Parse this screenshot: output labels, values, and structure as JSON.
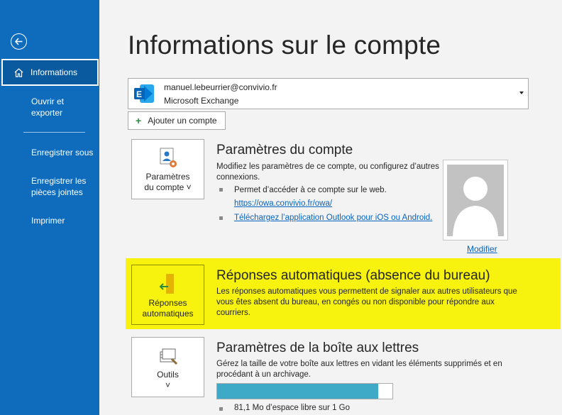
{
  "sidebar": {
    "back_icon": "back-arrow-icon",
    "items": [
      {
        "label": "Informations",
        "icon": "home-icon",
        "active": true
      },
      {
        "label": "Ouvrir et exporter"
      },
      {
        "label": "Enregistrer sous"
      },
      {
        "label": "Enregistrer les pièces jointes"
      },
      {
        "label": "Imprimer"
      }
    ]
  },
  "page": {
    "title": "Informations sur le compte"
  },
  "account": {
    "email": "manuel.lebeurrier@convivio.fr",
    "type": "Microsoft Exchange",
    "add_label": "Ajouter un compte"
  },
  "account_settings": {
    "tile_label_1": "Paramètres",
    "tile_label_2": "du compte ˅",
    "title": "Paramètres du compte",
    "desc": "Modifiez les paramètres de ce compte, ou configurez d’autres connexions.",
    "bullet1": "Permet d’accéder à ce compte sur le web.",
    "link1": "https://owa.convivio.fr/owa/",
    "link2": "Téléchargez l’application Outlook pour iOS ou Android.",
    "photo_link": "Modifier"
  },
  "auto_replies": {
    "tile_label_1": "Réponses",
    "tile_label_2": "automatiques",
    "title": "Réponses automatiques (absence du bureau)",
    "desc": "Les réponses automatiques vous permettent de signaler aux autres utilisateurs que vous êtes absent du bureau, en congés ou non disponible pour répondre aux courriers.",
    "highlight_color": "#f7f30e"
  },
  "mailbox": {
    "tile_label": "Outils",
    "tile_caret": "˅",
    "title": "Paramètres de la boîte aux lettres",
    "desc": "Gérez la taille de votre boîte aux lettres en vidant les éléments supprimés et en procédant à un archivage.",
    "usage_fraction": 0.92,
    "free_space": "81,1 Mo d’espace libre sur 1 Go"
  },
  "colors": {
    "sidebar": "#0f6cbd",
    "link": "#0563c1",
    "progress": "#3fa9c8"
  }
}
